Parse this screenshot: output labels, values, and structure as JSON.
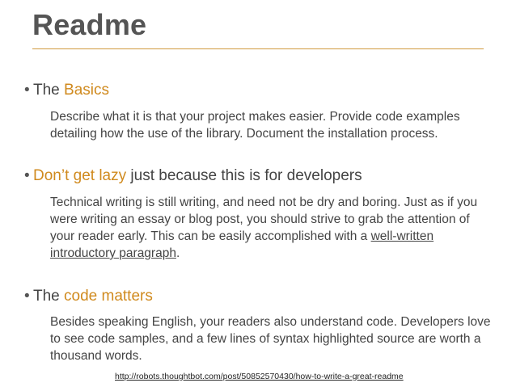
{
  "slide": {
    "title": "Readme",
    "sections": [
      {
        "bullet_prefix": "The ",
        "bullet_accent": "Basics",
        "bullet_suffix": "",
        "body": "Describe what it is that your project makes easier. Provide code examples detailing how the use of the library. Document the installation process."
      },
      {
        "bullet_prefix": "",
        "bullet_accent": "Don’t get lazy",
        "bullet_suffix": " just because this is for developers",
        "body": "Technical writing is still writing, and need not be dry and boring. Just as if you were writing an essay or blog post, you should strive to grab the attention of your reader early. This can be easily accomplished with a ",
        "body_link": "well-written introductory paragraph",
        "body_end": "."
      },
      {
        "bullet_prefix": "The ",
        "bullet_accent": "code matters",
        "bullet_suffix": "",
        "body": "Besides speaking English, your readers also understand code. Developers love to see code samples, and a few lines of syntax highlighted source are worth a thousand words."
      }
    ],
    "footer_url": "http://robots.thoughtbot.com/post/50852570430/how-to-write-a-great-readme"
  },
  "colors": {
    "accent": "#d08a1e",
    "rule": "#d09a3e",
    "text": "#444444"
  }
}
